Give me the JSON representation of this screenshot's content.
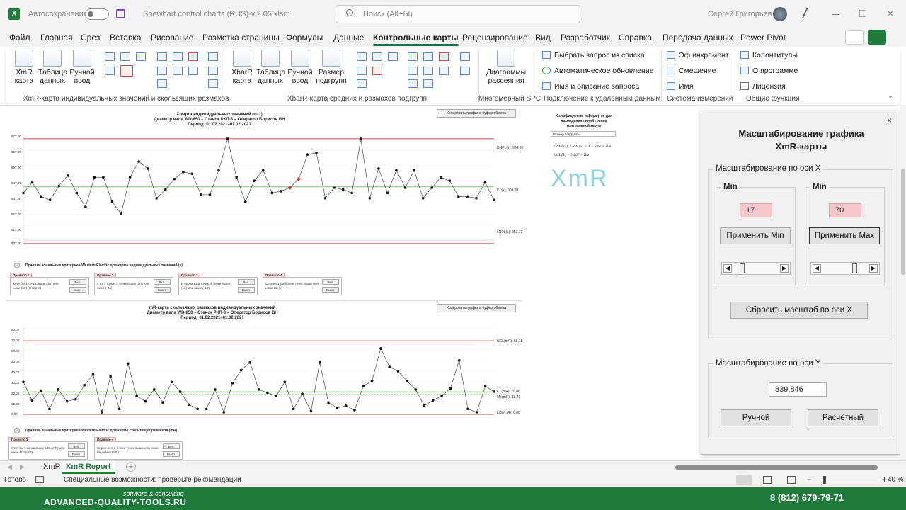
{
  "titlebar": {
    "autosave": "Автосохранение",
    "filename": "Shewhart control charts (RUS)-v.2.05.xlsm",
    "search": "Поиск (Alt+Ы)",
    "user": "Сергей Григорьев"
  },
  "tabs": [
    "Файл",
    "Главная",
    "Срез",
    "Вставка",
    "Рисование",
    "Разметка страницы",
    "Формулы",
    "Данные",
    "Контрольные карты",
    "Рецензирование",
    "Вид",
    "Разработчик",
    "Справка",
    "Передача данных",
    "Power Pivot"
  ],
  "ribbon": {
    "xmr_btns": [
      {
        "l1": "XmR",
        "l2": "карта",
        "icon": "xmr-chart-icon"
      },
      {
        "l1": "Таблица",
        "l2": "данных",
        "icon": "table-icon"
      },
      {
        "l1": "Ручной",
        "l2": "ввод",
        "icon": "keyboard-icon"
      }
    ],
    "xbar_btns": [
      {
        "l1": "XbarR",
        "l2": "карта",
        "icon": "xbar-chart-icon"
      },
      {
        "l1": "Таблица",
        "l2": "данных",
        "icon": "table-icon"
      },
      {
        "l1": "Ручной",
        "l2": "ввод",
        "icon": "keyboard-icon"
      },
      {
        "l1": "Размер",
        "l2": "подгрупп",
        "icon": "subgroup-icon"
      }
    ],
    "scatter_btn": {
      "l1": "Диаграммы",
      "l2": "рассеяния"
    },
    "groups": [
      "XmR-карта индивидуальных значений и скользящих размахов",
      "XbarR-карта средних и размахов подгрупп",
      "Многомерный SPC",
      "Подключение к удалённым данным",
      "Система измерений",
      "Общие функции"
    ],
    "remote": [
      "Выбрать запрос из списка",
      "Автоматическое обновление",
      "Имя и описание запроса"
    ],
    "measure": [
      "Эф инкремент",
      "Смещение",
      "Имя"
    ],
    "general": [
      "Колонтитулы",
      "О программе",
      "Лицензия"
    ]
  },
  "chart1": {
    "t1": "X-карта индивидуальных значений (n=1)",
    "t2": "Диаметр вала WD-850 – Станок РКП-3 – Оператор Борисов ВН",
    "t3": "Период: 01.02.2021–01.02.2021",
    "copy": "Копировать график в буфер обмена",
    "unpl": "UNPL(x); 964,60",
    "cl": "CL(x); 909,20",
    "lnpl": "LNPL(x); 853,72",
    "yticks": [
      "977,00",
      "967,00",
      "957,00",
      "947,00",
      "937,00",
      "927,00",
      "917,00",
      "907,00"
    ],
    "rules_title": "Правила зональных критериев Western Electric для карты индивидуальных значений (x)"
  },
  "rules1": [
    {
      "h": "Правило 1",
      "t": "Хотя бы 1 точка выше (3σ) или ниже (3σ) (X-карта)"
    },
    {
      "h": "Правило 2",
      "t": "8 из 3 точек, 2 точки выше (2σ) или ниже (-2σ)"
    },
    {
      "h": "Правило 3",
      "t": "В серии из 5 точек, 4 точки выше (1σ) или ниже (-1σ)"
    },
    {
      "h": "Правило 4",
      "t": "Серия из 8 и более точек выше или ниже CL (x)"
    }
  ],
  "chart2": {
    "t1": "mR-карта скользящих размахов индивидуальных значений",
    "t2": "Диаметр вала WD-850 – Станок РКП-3 – Оператор Борисов ВН",
    "t3": "Период: 01.02.2021–01.02.2021",
    "copy": "Копировать график в буфер обмена",
    "ucl": "UCL(mR); 68,15",
    "cl": "CL(mR); 20,86",
    "med": "Me(mR); 18,49",
    "lcl": "LCL(mR); 0,00",
    "yticks": [
      "80,00",
      "70,00",
      "60,00",
      "50,00",
      "40,00",
      "30,00",
      "20,00",
      "10,00",
      "0,00"
    ],
    "rules_title": "Правила зональных критериев Western Electric для карты скользящих размахов (mR)"
  },
  "rules2": [
    {
      "h": "Правило 1",
      "t": "Хотя бы 1 точка выше UCL(mR) или ниже LCL(mR)"
    },
    {
      "h": "Правило 4",
      "t": "Серия из 8 и более точек выше или ниже Медианы (mR)"
    }
  ],
  "btn_on": "Вкл.",
  "btn_off": "Выкл.",
  "formula": {
    "title": "Коэффициенты и формулы для нахождения линий границ контрольной карты",
    "sub": "Размер подгруппы",
    "f1": "UNPL(x), LNPL(x) = X̄ ± 2,66 × R̄m",
    "f2": "UCL(R) = 3,267 × R̄m",
    "logo": "XmR"
  },
  "dialog": {
    "title1": "Масштабирование графика",
    "title2": "XmR-карты",
    "xframe": "Масштабирование по оси X",
    "min1": "Min",
    "min2": "Min",
    "v1": "17",
    "v2": "70",
    "apply_min": "Применить Min",
    "apply_max": "Применить Max",
    "reset_x": "Сбросить масштаб по оси X",
    "yframe": "Масштабирование по оси Y",
    "yval": "839,846",
    "manual": "Ручной",
    "calc": "Расчётный"
  },
  "sheets": [
    "XmR",
    "XmR Report"
  ],
  "status": {
    "ready": "Готово",
    "access": "Специальные возможности: проверьте рекомендации",
    "zoom": "40 %"
  },
  "footer": {
    "small": "software & consulting",
    "site": "ADVANCED-QUALITY-TOOLS.RU",
    "phone": "8 (812) 679-79-71"
  },
  "chart_data": [
    {
      "type": "line",
      "title": "X-карта индивидуальных значений (n=1)",
      "ylabel": "",
      "ylim": [
        905,
        965
      ],
      "values": [
        932,
        938,
        930,
        928,
        936,
        942,
        932,
        924,
        941,
        941,
        927,
        920,
        941,
        950,
        946,
        929,
        934,
        940,
        944,
        943,
        931,
        931,
        945,
        963,
        941,
        927,
        939,
        945,
        932,
        933,
        935,
        940,
        954,
        955,
        929,
        935,
        934,
        932,
        963,
        929,
        946,
        932,
        945,
        935,
        945,
        929,
        935,
        941,
        939,
        930,
        930,
        929,
        938,
        928
      ],
      "ucl": 963,
      "cl": 935.5,
      "lcl": 903,
      "red_points": [
        30,
        31
      ]
    },
    {
      "type": "line",
      "title": "mR-карта скользящих размахов индивидуальных значений",
      "ylim": [
        0,
        80
      ],
      "values": [
        30,
        13,
        22,
        5,
        23,
        12,
        14,
        27,
        37,
        2,
        35,
        5,
        47,
        17,
        12,
        23,
        11,
        30,
        21,
        9,
        5,
        5,
        23,
        2,
        29,
        41,
        48,
        23,
        20,
        17,
        30,
        5,
        19,
        3,
        48,
        11,
        6,
        8,
        4,
        26,
        31,
        61,
        44,
        40,
        31,
        23,
        8,
        13,
        17,
        24,
        50,
        5,
        2,
        26,
        21
      ],
      "ucl": 68.15,
      "cl": 20.86,
      "median": 18.49,
      "lcl": 0
    }
  ]
}
